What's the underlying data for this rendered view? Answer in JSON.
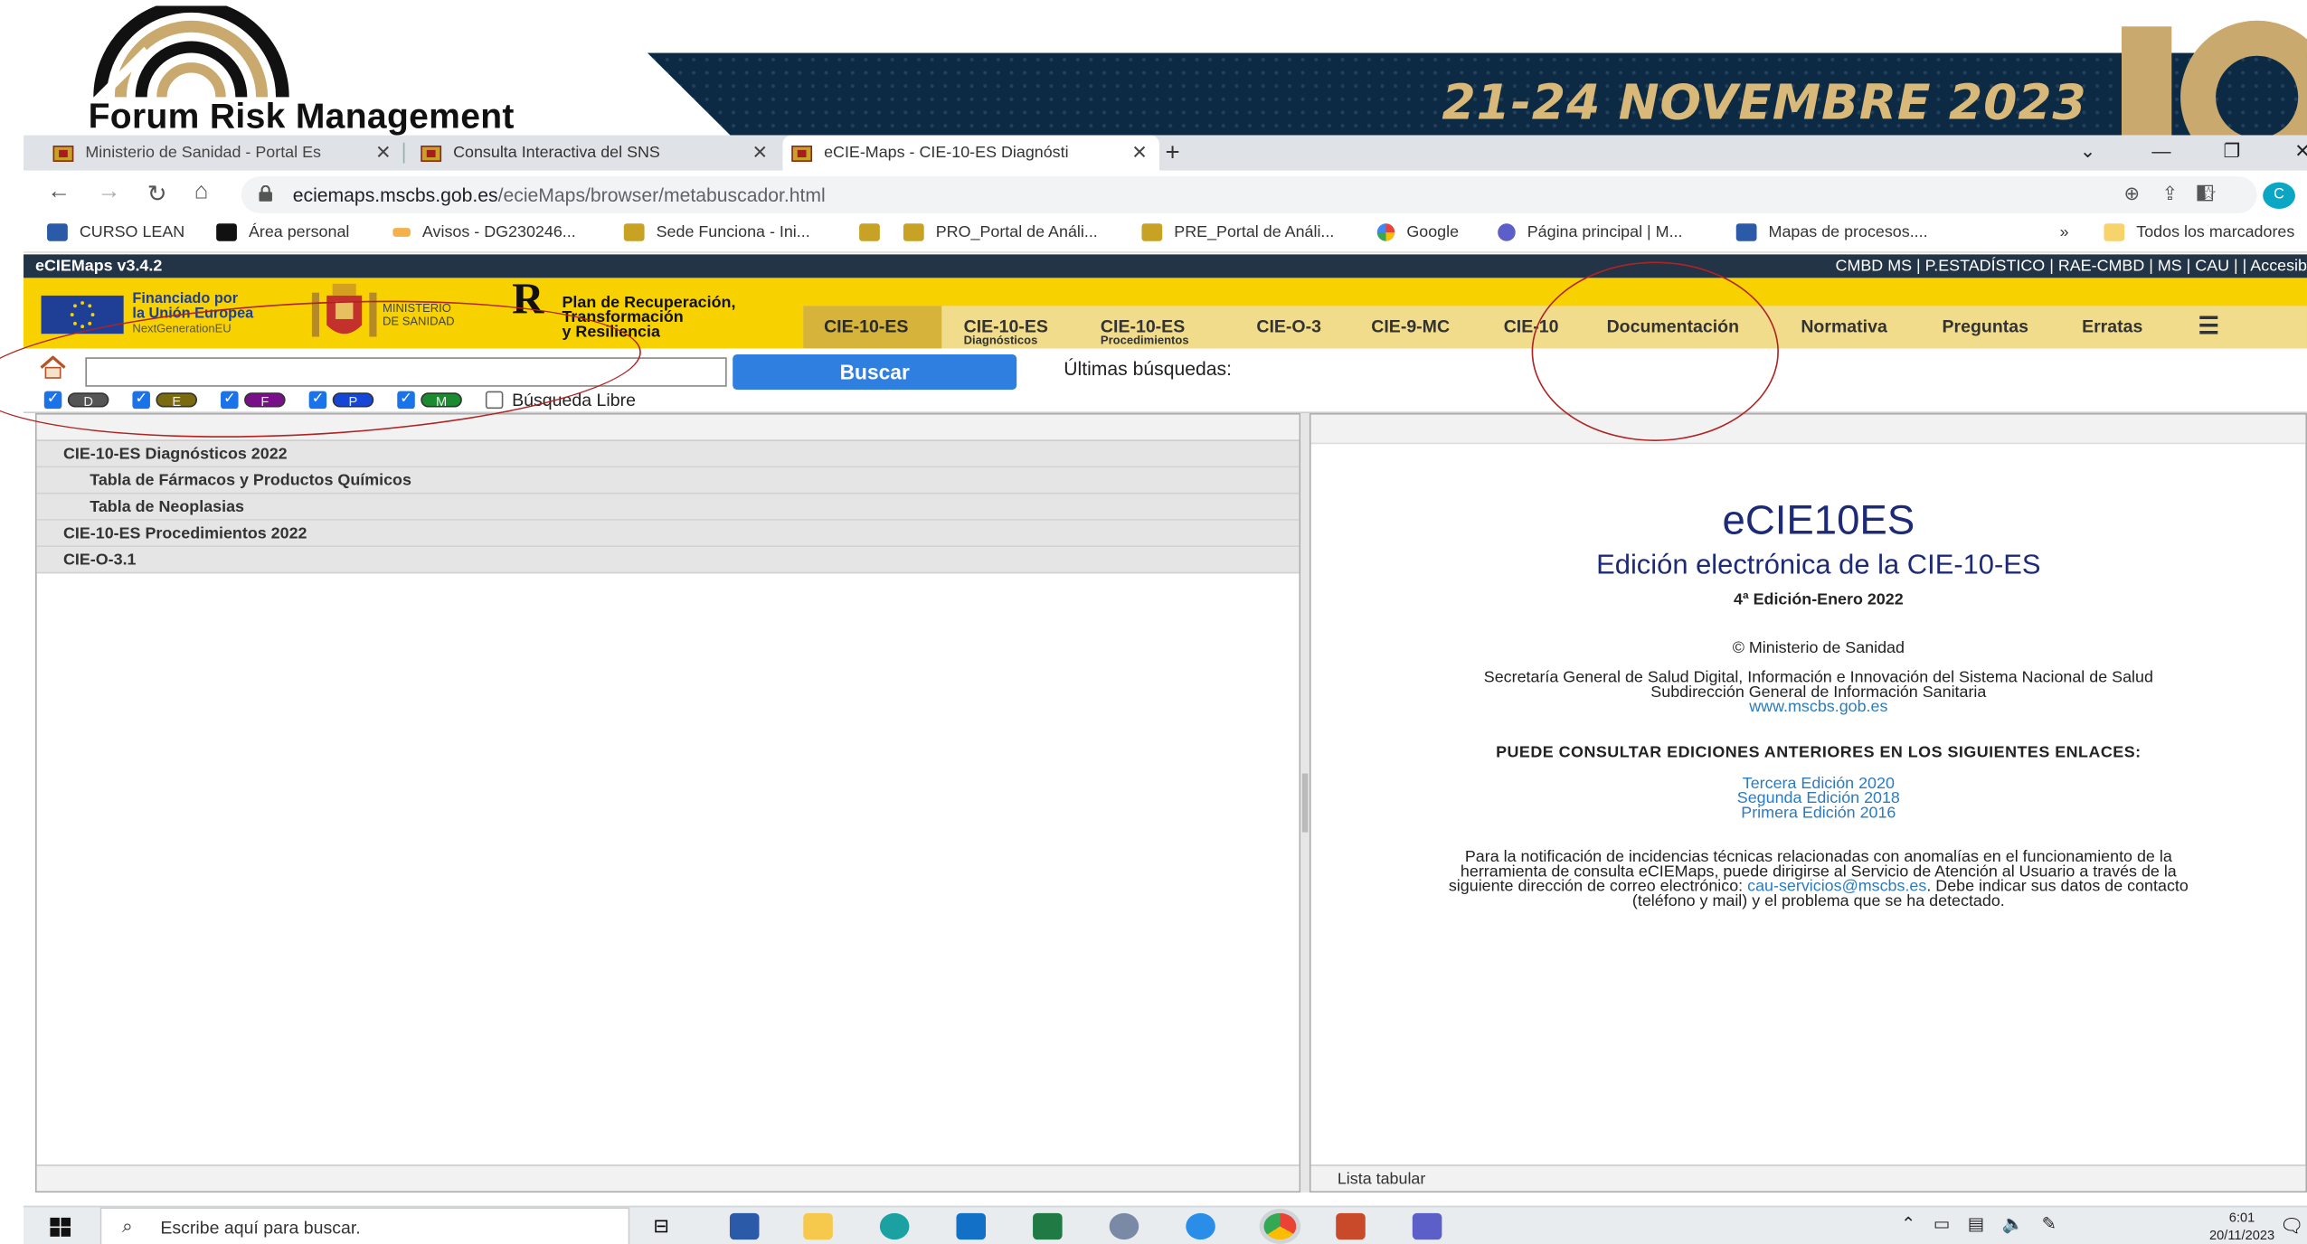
{
  "banner": {
    "logo_text": "Forum Risk Management",
    "date": "21-24 NOVEMBRE 2023"
  },
  "browser": {
    "tabs": [
      {
        "label": "Ministerio de Sanidad - Portal Es"
      },
      {
        "label": "Consulta Interactiva del SNS"
      },
      {
        "label": "eCIE-Maps - CIE-10-ES Diagnósti"
      }
    ],
    "new_tab": "+",
    "close_glyph": "✕",
    "url_domain": "eciemaps.mscbs.gob.es",
    "url_path": "/ecieMaps/browser/metabuscador.html",
    "avatar_letter": "C",
    "bookmarks": [
      {
        "label": "CURSO LEAN"
      },
      {
        "label": "Área personal"
      },
      {
        "label": "Avisos - DG230246..."
      },
      {
        "label": "Sede Funciona - Ini..."
      },
      {
        "label": "PRO_Portal de Análi..."
      },
      {
        "label": "PRE_Portal de Análi..."
      },
      {
        "label": "Google"
      },
      {
        "label": "Página principal | M..."
      },
      {
        "label": "Mapas de procesos...."
      },
      {
        "label": "»"
      },
      {
        "label": "Todos los marcadores"
      }
    ]
  },
  "app": {
    "title": "eCIEMaps v3.4.2",
    "top_links": "CMBD MS | P.ESTADÍSTICO | RAE-CMBD | MS | CAU | | Accesib",
    "eu_line1": "Financiado por",
    "eu_line2": "la Unión Europea",
    "eu_line3": "NextGenerationEU",
    "ministerio_line1": "MINISTERIO",
    "ministerio_line2": "DE SANIDAD",
    "prtr_letter": "R",
    "prtr_line1": "Plan de Recuperación,",
    "prtr_line2": "Transformación",
    "prtr_line3": "y Resiliencia",
    "nav": [
      {
        "label": "CIE-10-ES",
        "sub": ""
      },
      {
        "label": "CIE-10-ES",
        "sub": "Diagnósticos"
      },
      {
        "label": "CIE-10-ES",
        "sub": "Procedimientos"
      },
      {
        "label": "CIE-O-3",
        "sub": ""
      },
      {
        "label": "CIE-9-MC",
        "sub": ""
      },
      {
        "label": "CIE-10",
        "sub": ""
      },
      {
        "label": "Documentación",
        "sub": ""
      },
      {
        "label": "Normativa",
        "sub": ""
      },
      {
        "label": "Preguntas",
        "sub": ""
      },
      {
        "label": "Erratas",
        "sub": ""
      }
    ]
  },
  "search": {
    "input_value": "",
    "button": "Buscar",
    "recent_label": "Últimas búsquedas:",
    "filters": [
      {
        "letter": "D",
        "checked": true,
        "color": "#555555"
      },
      {
        "letter": "E",
        "checked": true,
        "color": "#7a6a10"
      },
      {
        "letter": "F",
        "checked": true,
        "color": "#7a0f8a"
      },
      {
        "letter": "P",
        "checked": true,
        "color": "#1546d8"
      },
      {
        "letter": "M",
        "checked": true,
        "color": "#1c8a2e"
      }
    ],
    "free_search_label": "Búsqueda Libre",
    "free_search_checked": false
  },
  "tree": [
    {
      "label": "CIE-10-ES Diagnósticos 2022",
      "level": 0
    },
    {
      "label": "Tabla de Fármacos y Productos Químicos",
      "level": 1
    },
    {
      "label": "Tabla de Neoplasias",
      "level": 1
    },
    {
      "label": "CIE-10-ES Procedimientos 2022",
      "level": 0
    },
    {
      "label": "CIE-O-3.1",
      "level": 0
    }
  ],
  "info": {
    "title": "eCIE10ES",
    "subtitle": "Edición electrónica de la CIE-10-ES",
    "edition": "4ª Edición-Enero 2022",
    "copyright": "© Ministerio de Sanidad",
    "org_line1": "Secretaría General de Salud Digital, Información e Innovación del Sistema Nacional de Salud",
    "org_line2": "Subdirección General de Información Sanitaria",
    "website": "www.mscbs.gob.es",
    "prev_heading": "PUEDE CONSULTAR EDICIONES ANTERIORES EN LOS SIGUIENTES ENLACES:",
    "prev_links": [
      "Tercera Edición 2020",
      "Segunda Edición 2018",
      "Primera Edición 2016"
    ],
    "notice_line1": "Para la notificación de incidencias técnicas relacionadas con anomalías en el funcionamiento de la",
    "notice_line2": "herramienta de consulta eCIEMaps, puede dirigirse al Servicio de Atención al Usuario a través de la",
    "notice_line3_pre": "siguiente dirección de correo electrónico:",
    "notice_email": "cau-servicios@mscbs.es",
    "notice_line3_post": ". Debe indicar sus datos de contacto",
    "notice_line4": "(teléfono y mail) y el problema que se ha detectado.",
    "footer_label": "Lista tabular"
  },
  "taskbar": {
    "search_placeholder": "Escribe aquí para buscar.",
    "time": "6:01",
    "date": "20/11/2023"
  }
}
